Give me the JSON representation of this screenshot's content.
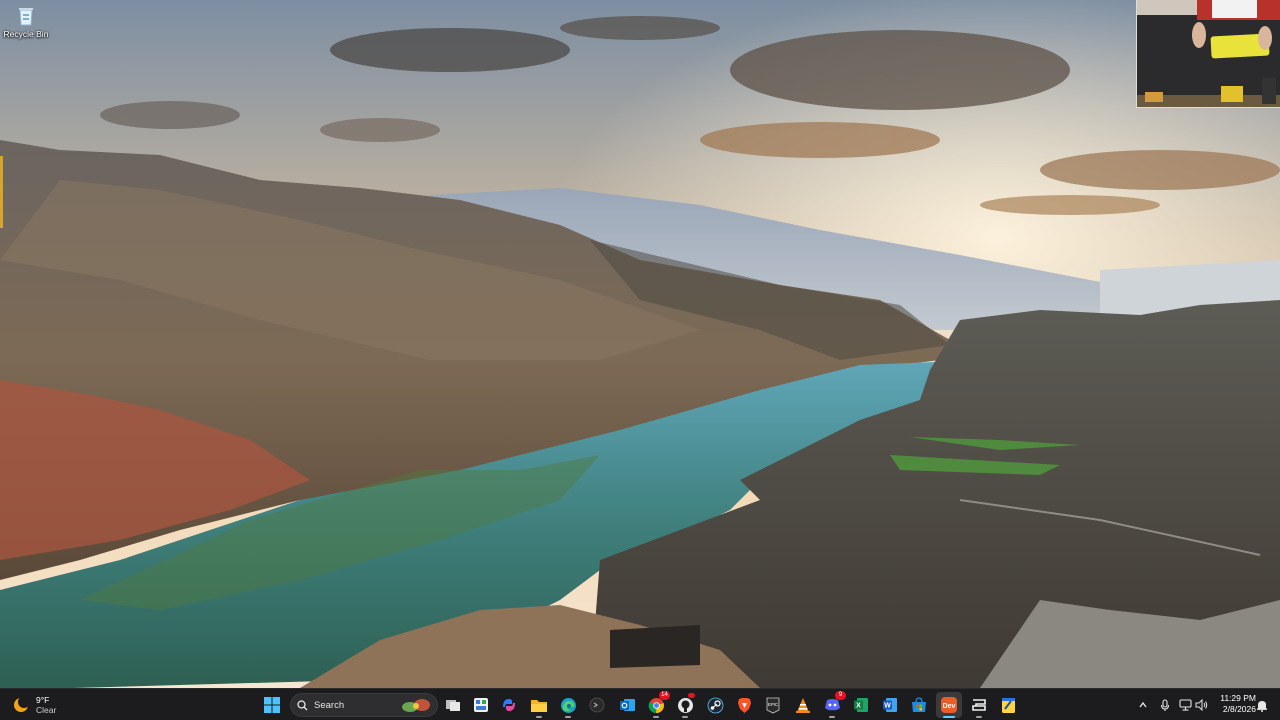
{
  "desktop": {
    "icons": [
      {
        "label": "Recycle Bin",
        "icon": "recycle-bin-icon"
      }
    ]
  },
  "taskbar": {
    "weather": {
      "temp": "9°F",
      "condition": "Clear",
      "icon": "moon-weather-icon"
    },
    "start_icon": "windows-start-icon",
    "search": {
      "label": "Search"
    },
    "apps": [
      {
        "name": "task-view",
        "icon": "task-view-icon"
      },
      {
        "name": "widgets",
        "icon": "widgets-icon"
      },
      {
        "name": "copilot",
        "icon": "copilot-icon"
      },
      {
        "name": "file-explorer",
        "icon": "folder-icon"
      },
      {
        "name": "edge",
        "icon": "edge-icon"
      },
      {
        "name": "terminal",
        "icon": "terminal-icon"
      },
      {
        "name": "outlook",
        "icon": "outlook-icon"
      },
      {
        "name": "chrome",
        "icon": "chrome-icon",
        "badge": "14"
      },
      {
        "name": "github",
        "icon": "github-icon"
      },
      {
        "name": "steam",
        "icon": "steam-icon"
      },
      {
        "name": "brave",
        "icon": "brave-icon"
      },
      {
        "name": "epic-games",
        "icon": "epic-games-icon",
        "text": "EPIC"
      },
      {
        "name": "vlc",
        "icon": "vlc-icon"
      },
      {
        "name": "discord",
        "icon": "discord-icon",
        "badge": "9"
      },
      {
        "name": "excel",
        "icon": "excel-icon",
        "text": "X"
      },
      {
        "name": "word",
        "icon": "word-icon",
        "text": "W"
      },
      {
        "name": "ms-store",
        "icon": "store-icon"
      },
      {
        "name": "app-dev",
        "icon": "dev-app-icon",
        "text": "Dev"
      },
      {
        "name": "capcut",
        "icon": "capcut-icon"
      },
      {
        "name": "sticky-app",
        "icon": "sticky-app-icon"
      }
    ],
    "tray": {
      "overflow_icon": "chevron-up-icon",
      "mic_icon": "microphone-icon",
      "network_icon": "network-icon",
      "volume_icon": "volume-icon",
      "battery_icon": "battery-icon"
    },
    "clock": {
      "time": "11:29 PM",
      "date": "2/8/2026"
    },
    "notifications_icon": "notification-bell-icon"
  },
  "colors": {
    "taskbar_bg": "#1c1c1e",
    "accent": "#60cdff",
    "badge": "#e81123"
  }
}
